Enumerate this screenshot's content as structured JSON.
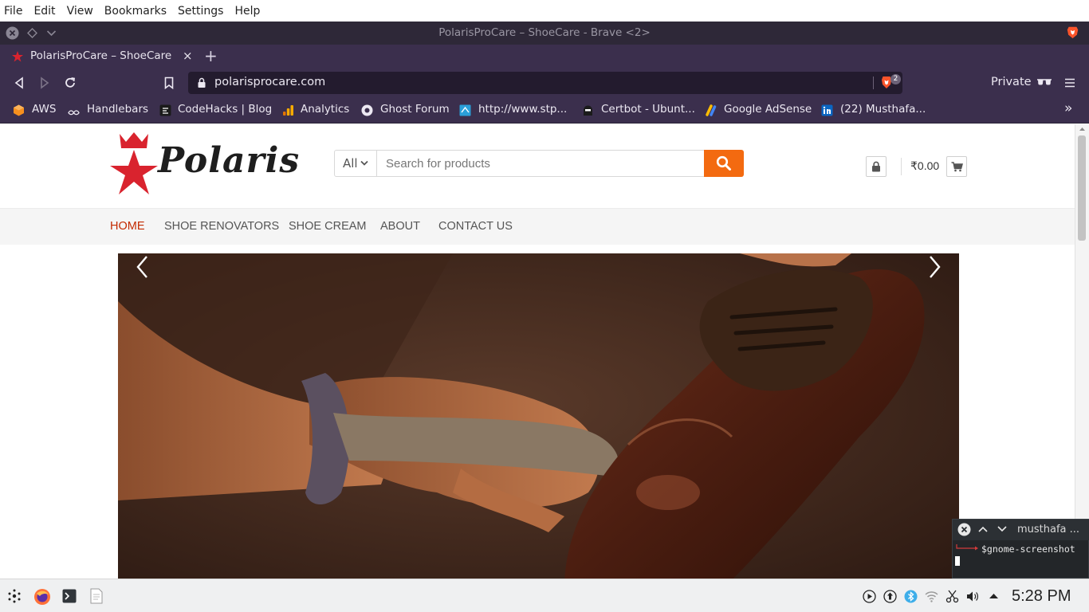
{
  "app_menu": [
    "File",
    "Edit",
    "View",
    "Bookmarks",
    "Settings",
    "Help"
  ],
  "window": {
    "title": "PolarisProCare – ShoeCare - Brave <2>"
  },
  "tab": {
    "label": "PolarisProCare – ShoeCare",
    "close": "×"
  },
  "newtab": "+",
  "toolbar": {
    "url": "polarisprocare.com",
    "shields_count": "2",
    "private_label": "Private"
  },
  "bookmarks": [
    {
      "label": "AWS",
      "icon": "aws-icon"
    },
    {
      "label": "Handlebars",
      "icon": "handlebars-icon"
    },
    {
      "label": "CodeHacks | Blog",
      "icon": "codehacks-icon"
    },
    {
      "label": "Analytics",
      "icon": "analytics-icon"
    },
    {
      "label": "Ghost Forum",
      "icon": "ghost-icon"
    },
    {
      "label": "http://www.stp...",
      "icon": "web-icon"
    },
    {
      "label": "Certbot - Ubunt...",
      "icon": "certbot-icon"
    },
    {
      "label": "Google AdSense",
      "icon": "adsense-icon"
    },
    {
      "label": "(22) Musthafa...",
      "icon": "linkedin-icon"
    }
  ],
  "bookmarks_overflow": "»",
  "site": {
    "logo": "Polaris",
    "search": {
      "category": "All",
      "placeholder": "Search for products"
    },
    "cart_total": "₹0.00",
    "nav": [
      "HOME",
      "SHOE RENOVATORS",
      "SHOE CREAM",
      "ABOUT",
      "CONTACT US"
    ],
    "active_nav": "HOME"
  },
  "terminal": {
    "title": "musthafa ...",
    "command": "$gnome-screenshot"
  },
  "taskbar": {
    "clock": "5:28 PM"
  },
  "colors": {
    "brand_red": "#d9232e",
    "search_orange": "#f36a10",
    "nav_active": "#c32a00",
    "browser_purple": "#3b2f4d"
  }
}
